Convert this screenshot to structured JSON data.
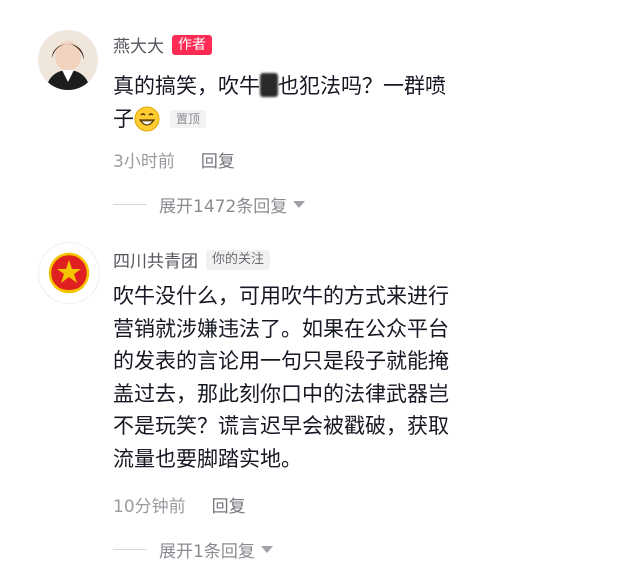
{
  "comments": [
    {
      "username": "燕大大",
      "badge": "作者",
      "text_a": "真的搞笑，吹牛",
      "text_b": "也犯法吗？一群喷",
      "text_c": "子",
      "emoji": "grinning-face-icon",
      "pinned": "置顶",
      "time": "3小时前",
      "reply": "回复",
      "expand": "展开1472条回复"
    },
    {
      "username": "四川共青团",
      "badge": "你的关注",
      "lines": [
        "吹牛没什么，可用吹牛的方式来进行",
        "营销就涉嫌违法了。如果在公众平台",
        "的发表的言论用一句只是段子就能掩",
        "盖过去，那此刻你口中的法律武器岂",
        "不是玩笑？谎言迟早会被戳破，获取",
        "流量也要脚踏实地。"
      ],
      "time": "10分钟前",
      "reply": "回复",
      "expand": "展开1条回复"
    }
  ],
  "colors": {
    "author_badge": "#fe2c55",
    "league_red": "#e02020"
  }
}
